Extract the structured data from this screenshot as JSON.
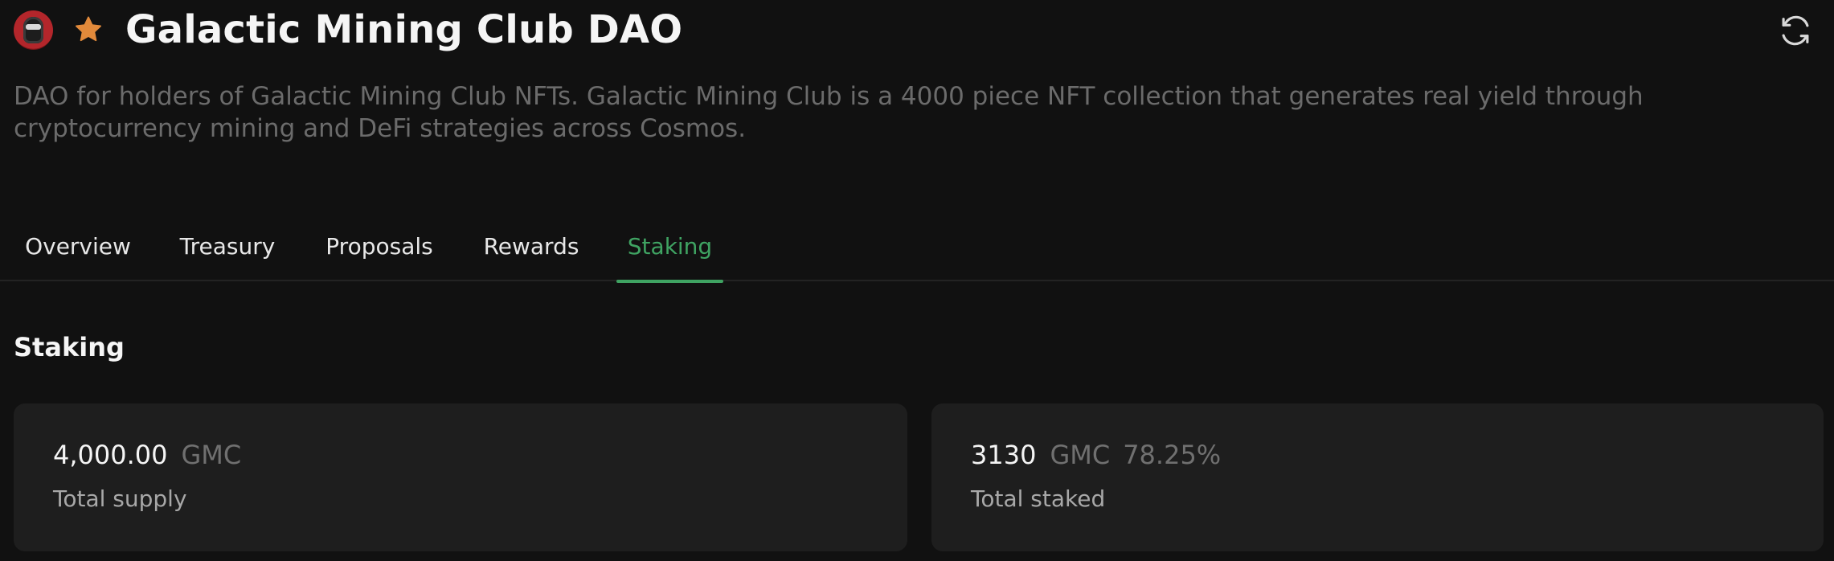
{
  "header": {
    "title": "Galactic Mining Club DAO",
    "avatar_icon": "dao-avatar-icon",
    "star_icon": "star-icon",
    "refresh_icon": "refresh-icon",
    "star_color": "#e28a3b"
  },
  "description": "DAO for holders of Galactic Mining Club NFTs. Galactic Mining Club is a 4000 piece NFT collection that generates real yield through cryptocurrency mining and DeFi strategies across Cosmos.",
  "tabs": [
    {
      "label": "Overview",
      "active": false
    },
    {
      "label": "Treasury",
      "active": false
    },
    {
      "label": "Proposals",
      "active": false
    },
    {
      "label": "Rewards",
      "active": false
    },
    {
      "label": "Staking",
      "active": true
    }
  ],
  "staking": {
    "section_title": "Staking",
    "total_supply": {
      "value": "4,000.00",
      "unit": "GMC",
      "label": "Total supply"
    },
    "total_staked": {
      "value": "3130",
      "unit": "GMC",
      "percent": "78.25%",
      "label": "Total staked"
    }
  },
  "colors": {
    "background": "#111111",
    "card": "#1e1e1e",
    "accent": "#3fa362",
    "muted_text": "#6b6b6b"
  }
}
